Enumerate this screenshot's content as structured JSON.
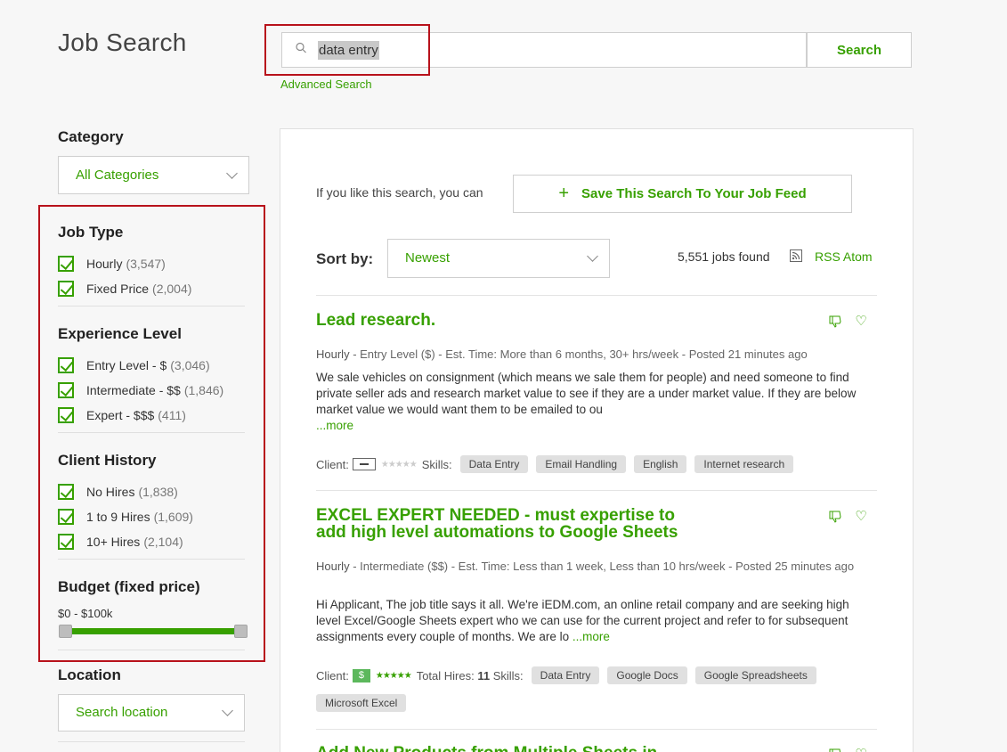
{
  "page_title": "Job Search",
  "search": {
    "value": "data entry",
    "button": "Search",
    "advanced": "Advanced Search"
  },
  "sidebar": {
    "category_heading": "Category",
    "category_value": "All Categories",
    "job_type": {
      "heading": "Job Type",
      "items": [
        {
          "label": "Hourly",
          "count": "(3,547)"
        },
        {
          "label": "Fixed Price",
          "count": "(2,004)"
        }
      ]
    },
    "experience": {
      "heading": "Experience Level",
      "items": [
        {
          "label": "Entry Level - $",
          "count": "(3,046)"
        },
        {
          "label": "Intermediate - $$",
          "count": "(1,846)"
        },
        {
          "label": "Expert - $$$",
          "count": "(411)"
        }
      ]
    },
    "client_history": {
      "heading": "Client History",
      "items": [
        {
          "label": "No Hires",
          "count": "(1,838)"
        },
        {
          "label": "1 to 9 Hires",
          "count": "(1,609)"
        },
        {
          "label": "10+ Hires",
          "count": "(2,104)"
        }
      ]
    },
    "budget": {
      "heading": "Budget (fixed price)",
      "range": "$0 - $100k"
    },
    "location": {
      "heading": "Location",
      "placeholder": "Search location"
    }
  },
  "main": {
    "like_text": "If you like this search, you can",
    "save_button": "Save This Search To Your Job Feed",
    "sort_label": "Sort by:",
    "sort_value": "Newest",
    "jobs_found": "5,551 jobs found",
    "rss": "RSS Atom",
    "jobs": [
      {
        "title": "Lead research.",
        "meta_type": "Hourly",
        "meta_rest": " - Entry Level ($) - Est. Time: More than 6 months, 30+ hrs/week - Posted 21 minutes ago",
        "desc": "We sale vehicles on consignment (which means we sale them for people) and need someone to find private seller ads and research market value to see if they are a under market value. If they are below market value we would want them to be emailed to ou",
        "more": "...more",
        "client_label": "Client:",
        "skills_label": "Skills:",
        "skills": [
          "Data Entry",
          "Email Handling",
          "English",
          "Internet research"
        ]
      },
      {
        "title_line1": "EXCEL EXPERT NEEDED - must expertise to",
        "title_line2": "add high level automations to Google Sheets",
        "meta_type": "Hourly",
        "meta_rest": " - Intermediate ($$) - Est. Time: Less than 1 week, Less than 10 hrs/week - Posted 25 minutes ago",
        "desc": "Hi Applicant, The job title says it all. We're iEDM.com, an online retail company and are seeking high level Excel/Google Sheets expert who we can use for the current project and refer to for subsequent assignments every couple of months. We are lo ",
        "more": "...more",
        "client_label": "Client:",
        "total_hires_label": "Total Hires:",
        "total_hires": "11",
        "skills_label": "Skills:",
        "skills": [
          "Data Entry",
          "Google Docs",
          "Google Spreadsheets",
          "Microsoft Excel"
        ]
      },
      {
        "title": "Add New Products from Multiple Sheets in"
      }
    ]
  }
}
